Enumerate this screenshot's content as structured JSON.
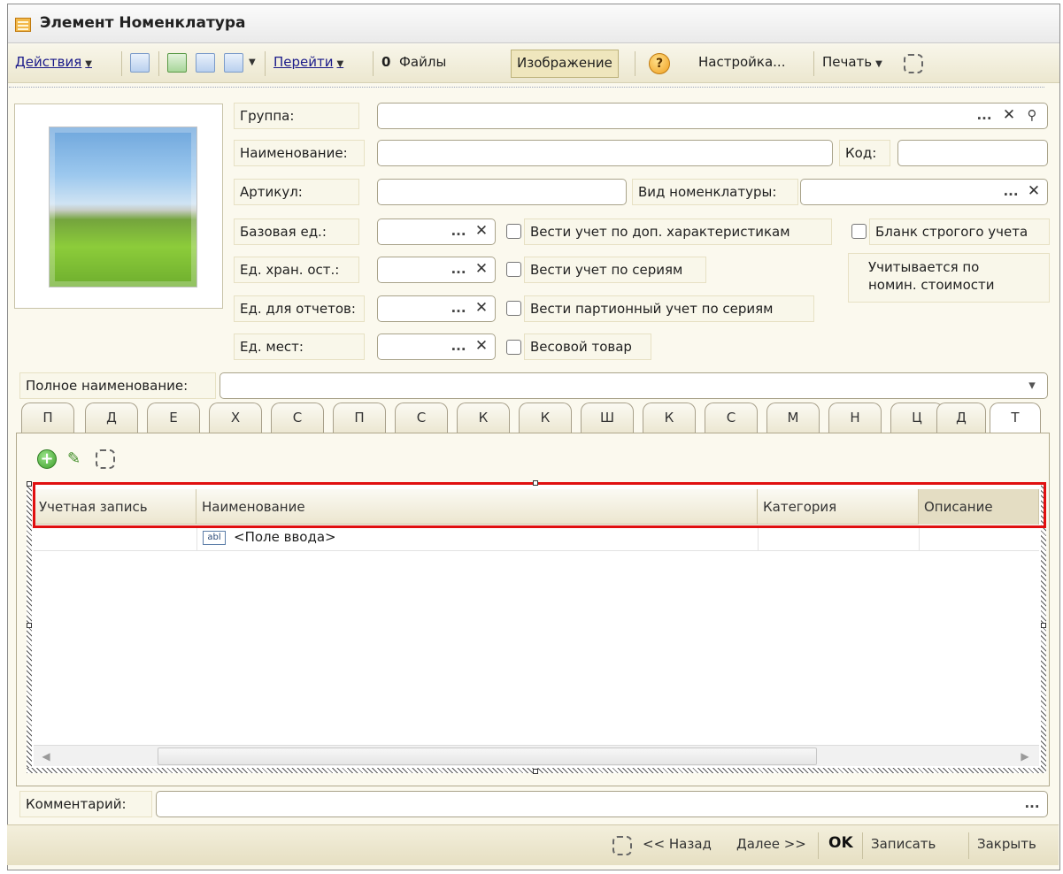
{
  "window": {
    "title": "Элемент Номенклатура"
  },
  "toolbar": {
    "actions_label": "Действия",
    "goto_label": "Перейти",
    "files_label": "Файлы",
    "image_label": "Изображение",
    "settings_label": "Настройка...",
    "print_label": "Печать",
    "help_symbol": "?",
    "clip_symbol": "0"
  },
  "form": {
    "group_label": "Группа:",
    "name_label": "Наименование:",
    "code_label": "Код:",
    "article_label": "Артикул:",
    "nomenclature_type_label": "Вид номенклатуры:",
    "base_unit_label": "Базовая ед.:",
    "storage_unit_label": "Ед. хран. ост.:",
    "report_unit_label": "Ед. для отчетов:",
    "place_unit_label": "Ед. мест:",
    "full_name_label": "Полное наименование:",
    "comment_label": "Комментарий:",
    "select_btn": "...",
    "clear_btn": "✕",
    "search_btn": "⚲",
    "dropdown_btn": "▾"
  },
  "checkboxes": {
    "extra_characteristics": "Вести учет по доп. характеристикам",
    "strict_form": "Бланк строгого учета",
    "by_series": "Вести учет по сериям",
    "nominal_value_line1": "Учитывается по",
    "nominal_value_line2": "номин. стоимости",
    "batch_by_series": "Вести партионный учет по сериям",
    "weight_goods": "Весовой товар"
  },
  "tabs": [
    "П",
    "Д",
    "Е",
    "Х",
    "С",
    "П",
    "С",
    "К",
    "К",
    "Ш",
    "К",
    "С",
    "М",
    "Н",
    "Ц",
    "Д",
    "Т"
  ],
  "grid": {
    "columns": [
      "Учетная запись",
      "Наименование",
      "Категория",
      "Описание"
    ],
    "row_icon": "abl",
    "row_text": "<Поле ввода>"
  },
  "footer": {
    "back_label": "<< Назад",
    "next_label": "Далее >>",
    "ok_label": "OK",
    "save_label": "Записать",
    "close_label": "Закрыть"
  },
  "colors": {
    "highlight": "#e01010",
    "accent_tab": "#ffffff"
  }
}
